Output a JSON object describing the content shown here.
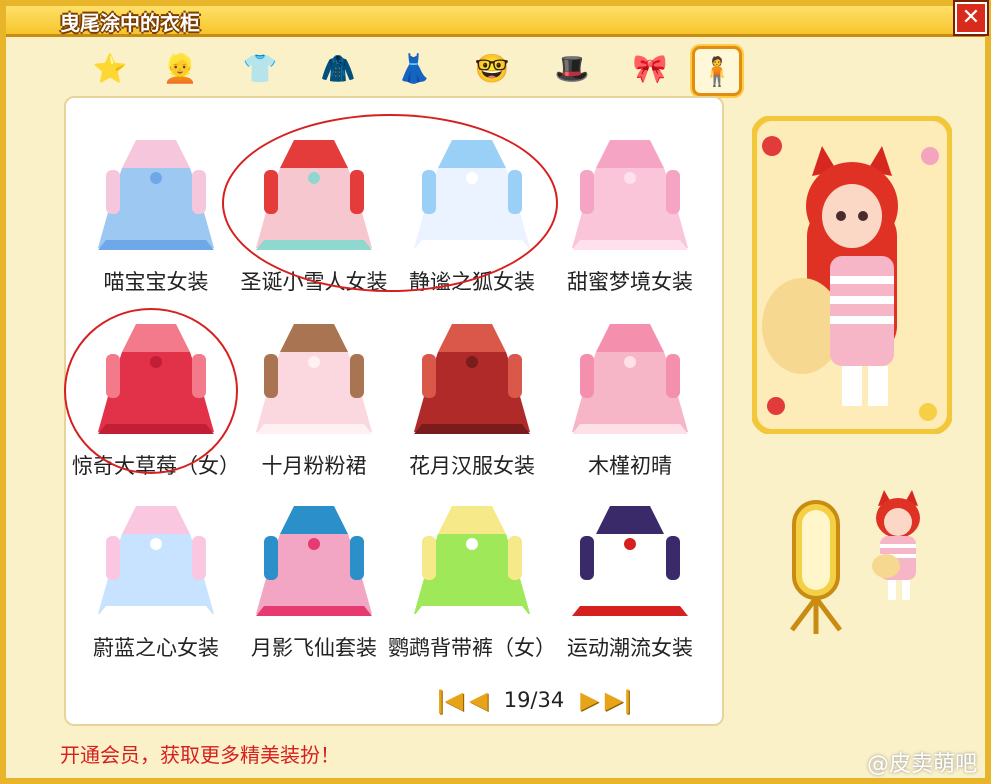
{
  "window": {
    "title": "曳尾涂中的衣柜",
    "close_label": "✕"
  },
  "tabs": [
    {
      "name": "favorites",
      "glyph": "⭐"
    },
    {
      "name": "hair",
      "glyph": "👱"
    },
    {
      "name": "top",
      "glyph": "👕"
    },
    {
      "name": "coat",
      "glyph": "🧥"
    },
    {
      "name": "skirt",
      "glyph": "👗"
    },
    {
      "name": "face",
      "glyph": "🤓"
    },
    {
      "name": "hat",
      "glyph": "🎩"
    },
    {
      "name": "accessory",
      "glyph": "🎀"
    },
    {
      "name": "suit",
      "glyph": "🧍"
    }
  ],
  "items": [
    {
      "label": "喵宝宝女装",
      "colors": [
        "#9cc8f2",
        "#f6c6dc",
        "#6fa8e8"
      ]
    },
    {
      "label": "圣诞小雪人女装",
      "colors": [
        "#f7c7d0",
        "#e43b3b",
        "#8fd8d0"
      ]
    },
    {
      "label": "静谧之狐女装",
      "colors": [
        "#eaf3ff",
        "#9ad0f5",
        "#ffffff"
      ]
    },
    {
      "label": "甜蜜梦境女装",
      "colors": [
        "#fbc5d9",
        "#f6a4c4",
        "#ffe0ec"
      ]
    },
    {
      "label": "惊奇大草莓（女）",
      "colors": [
        "#e2324a",
        "#f27a8a",
        "#c21e35"
      ]
    },
    {
      "label": "十月粉粉裙",
      "colors": [
        "#fbd7df",
        "#a97451",
        "#fff0f3"
      ]
    },
    {
      "label": "花月汉服女装",
      "colors": [
        "#b02a2a",
        "#d9584a",
        "#7a1c1c"
      ]
    },
    {
      "label": "木槿初晴",
      "colors": [
        "#f7b6c8",
        "#f58fae",
        "#fde0e8"
      ]
    },
    {
      "label": "蔚蓝之心女装",
      "colors": [
        "#c7e3ff",
        "#f9c7e0",
        "#ffffff"
      ]
    },
    {
      "label": "月影飞仙套装",
      "colors": [
        "#f2a6c4",
        "#2b8fc9",
        "#e63a70"
      ]
    },
    {
      "label": "鹦鹉背带裤（女）",
      "colors": [
        "#9ee85a",
        "#f6e98a",
        "#ffffff"
      ]
    },
    {
      "label": "运动潮流女装",
      "colors": [
        "#ffffff",
        "#3a2a6a",
        "#d62020"
      ]
    }
  ],
  "pager": {
    "first": "|◀",
    "prev": "◀",
    "page": "19/34",
    "next": "▶",
    "last": "▶|"
  },
  "footer": {
    "promo": "开通会员，获取更多精美装扮！"
  },
  "watermark": "@皮卖萌吧",
  "colors": {
    "frame": "#e8b52a",
    "highlight_circle": "#d62020",
    "promo_text": "#d62020"
  }
}
